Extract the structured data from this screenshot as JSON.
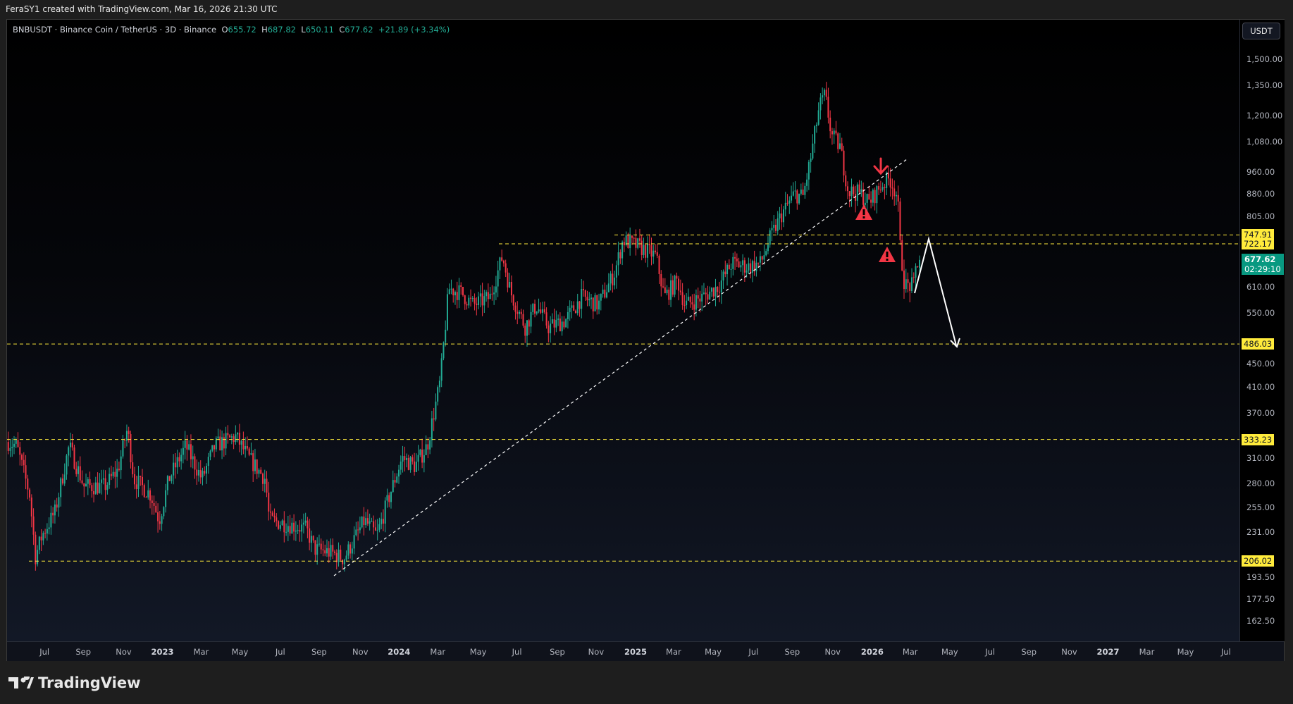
{
  "header": {
    "attribution": "FeraSY1 created with TradingView.com, Mar 16, 2026 21:30 UTC"
  },
  "legend": {
    "symbol": "BNBUSDT · Binance Coin / TetherUS · 3D · Binance",
    "o_label": "O",
    "open": "655.72",
    "h_label": "H",
    "high": "687.82",
    "l_label": "L",
    "low": "650.11",
    "c_label": "C",
    "close": "677.62",
    "change": "+21.89 (+3.34%)"
  },
  "price_axis": {
    "unit": "USDT",
    "ticks": [
      "1,500.00",
      "1,350.00",
      "1,200.00",
      "1,080.00",
      "960.00",
      "880.00",
      "805.00",
      "610.00",
      "550.00",
      "450.00",
      "410.00",
      "370.00",
      "310.00",
      "280.00",
      "255.00",
      "231.00",
      "193.50",
      "177.50",
      "162.50"
    ],
    "current_price": "677.62",
    "countdown": "02:29:10"
  },
  "levels": [
    "747.91",
    "722.17",
    "486.03",
    "333.23",
    "206.02"
  ],
  "time_axis": {
    "ticks": [
      "Jul",
      "Sep",
      "Nov",
      "2023",
      "Mar",
      "May",
      "Jul",
      "Sep",
      "Nov",
      "2024",
      "Mar",
      "May",
      "Jul",
      "Sep",
      "Nov",
      "2025",
      "Mar",
      "May",
      "Jul",
      "Sep",
      "Nov",
      "2026",
      "Mar",
      "May",
      "Jul",
      "Sep",
      "Nov",
      "2027",
      "Mar",
      "May",
      "Jul"
    ]
  },
  "colors": {
    "up": "#22ab94",
    "down": "#f23645",
    "level": "#ffeb3b",
    "annotation": "#f23645"
  },
  "brand": {
    "name": "TradingView"
  },
  "chart_data": {
    "type": "candlestick",
    "interval": "3D",
    "scale": "log",
    "price_path": [
      [
        "2022-05-08",
        330
      ],
      [
        "2022-05-21",
        325
      ],
      [
        "2022-06-10",
        268
      ],
      [
        "2022-06-19",
        210
      ],
      [
        "2022-06-29",
        228
      ],
      [
        "2022-07-19",
        250
      ],
      [
        "2022-08-10",
        325
      ],
      [
        "2022-09-02",
        277
      ],
      [
        "2022-10-04",
        277
      ],
      [
        "2022-10-24",
        295
      ],
      [
        "2022-11-08",
        348
      ],
      [
        "2022-11-18",
        285
      ],
      [
        "2022-12-14",
        268
      ],
      [
        "2022-12-27",
        242
      ],
      [
        "2023-01-11",
        285
      ],
      [
        "2023-02-06",
        325
      ],
      [
        "2023-03-03",
        285
      ],
      [
        "2023-03-23",
        325
      ],
      [
        "2023-04-24",
        337
      ],
      [
        "2023-05-14",
        310
      ],
      [
        "2023-06-09",
        285
      ],
      [
        "2023-06-15",
        242
      ],
      [
        "2023-07-10",
        239
      ],
      [
        "2023-08-11",
        234
      ],
      [
        "2023-08-24",
        216
      ],
      [
        "2023-09-19",
        213
      ],
      [
        "2023-10-08",
        208
      ],
      [
        "2023-11-09",
        242
      ],
      [
        "2023-11-28",
        228
      ],
      [
        "2023-12-18",
        268
      ],
      [
        "2024-01-06",
        310
      ],
      [
        "2024-01-26",
        300
      ],
      [
        "2024-02-14",
        325
      ],
      [
        "2024-03-05",
        420
      ],
      [
        "2024-03-18",
        605
      ],
      [
        "2024-04-06",
        595
      ],
      [
        "2024-04-25",
        567
      ],
      [
        "2024-05-21",
        585
      ],
      [
        "2024-06-09",
        688
      ],
      [
        "2024-06-22",
        595
      ],
      [
        "2024-07-14",
        520
      ],
      [
        "2024-07-31",
        567
      ],
      [
        "2024-08-19",
        520
      ],
      [
        "2024-09-14",
        533
      ],
      [
        "2024-10-09",
        585
      ],
      [
        "2024-11-04",
        567
      ],
      [
        "2024-11-29",
        643
      ],
      [
        "2024-12-12",
        733
      ],
      [
        "2025-01-07",
        713
      ],
      [
        "2025-02-01",
        688
      ],
      [
        "2025-02-14",
        585
      ],
      [
        "2025-03-06",
        625
      ],
      [
        "2025-03-18",
        567
      ],
      [
        "2025-04-14",
        585
      ],
      [
        "2025-05-09",
        612
      ],
      [
        "2025-05-29",
        669
      ],
      [
        "2025-06-23",
        660
      ],
      [
        "2025-07-13",
        669
      ],
      [
        "2025-07-26",
        733
      ],
      [
        "2025-08-14",
        811
      ],
      [
        "2025-09-03",
        880
      ],
      [
        "2025-09-16",
        870
      ],
      [
        "2025-09-28",
        1015
      ],
      [
        "2025-10-11",
        1240
      ],
      [
        "2025-10-20",
        1300
      ],
      [
        "2025-10-30",
        1110
      ],
      [
        "2025-11-12",
        1060
      ],
      [
        "2025-11-25",
        890
      ],
      [
        "2025-12-14",
        880
      ],
      [
        "2025-12-27",
        850
      ],
      [
        "2026-01-15",
        910
      ],
      [
        "2026-01-28",
        935
      ],
      [
        "2026-02-09",
        870
      ],
      [
        "2026-02-13",
        713
      ],
      [
        "2026-02-20",
        612
      ],
      [
        "2026-03-06",
        612
      ],
      [
        "2026-03-10",
        669
      ],
      [
        "2026-03-16",
        677.62
      ]
    ],
    "ylim": [
      155,
      1600
    ]
  }
}
